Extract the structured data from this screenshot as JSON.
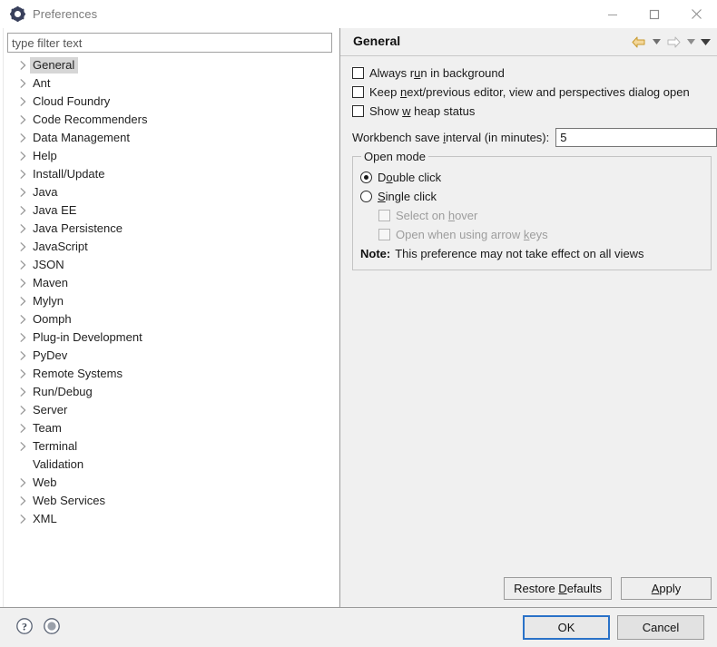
{
  "window": {
    "title": "Preferences",
    "icon": "gear-icon",
    "controls": {
      "minimize": "minimize-icon",
      "maximize": "maximize-icon",
      "close": "close-icon"
    }
  },
  "filter": {
    "placeholder": "type filter text",
    "value": ""
  },
  "tree": {
    "items": [
      {
        "label": "General",
        "expandable": true,
        "selected": true
      },
      {
        "label": "Ant",
        "expandable": true,
        "selected": false
      },
      {
        "label": "Cloud Foundry",
        "expandable": true,
        "selected": false
      },
      {
        "label": "Code Recommenders",
        "expandable": true,
        "selected": false
      },
      {
        "label": "Data Management",
        "expandable": true,
        "selected": false
      },
      {
        "label": "Help",
        "expandable": true,
        "selected": false
      },
      {
        "label": "Install/Update",
        "expandable": true,
        "selected": false
      },
      {
        "label": "Java",
        "expandable": true,
        "selected": false
      },
      {
        "label": "Java EE",
        "expandable": true,
        "selected": false
      },
      {
        "label": "Java Persistence",
        "expandable": true,
        "selected": false
      },
      {
        "label": "JavaScript",
        "expandable": true,
        "selected": false
      },
      {
        "label": "JSON",
        "expandable": true,
        "selected": false
      },
      {
        "label": "Maven",
        "expandable": true,
        "selected": false
      },
      {
        "label": "Mylyn",
        "expandable": true,
        "selected": false
      },
      {
        "label": "Oomph",
        "expandable": true,
        "selected": false
      },
      {
        "label": "Plug-in Development",
        "expandable": true,
        "selected": false
      },
      {
        "label": "PyDev",
        "expandable": true,
        "selected": false
      },
      {
        "label": "Remote Systems",
        "expandable": true,
        "selected": false
      },
      {
        "label": "Run/Debug",
        "expandable": true,
        "selected": false
      },
      {
        "label": "Server",
        "expandable": true,
        "selected": false
      },
      {
        "label": "Team",
        "expandable": true,
        "selected": false
      },
      {
        "label": "Terminal",
        "expandable": true,
        "selected": false
      },
      {
        "label": "Validation",
        "expandable": false,
        "selected": false
      },
      {
        "label": "Web",
        "expandable": true,
        "selected": false
      },
      {
        "label": "Web Services",
        "expandable": true,
        "selected": false
      },
      {
        "label": "XML",
        "expandable": true,
        "selected": false
      }
    ]
  },
  "pane": {
    "title": "General",
    "nav": {
      "back": "back-arrow-icon",
      "back_menu": "chevron-down-icon",
      "forward": "forward-arrow-icon",
      "forward_menu": "chevron-down-icon",
      "view_menu": "chevron-down-icon"
    },
    "checkboxes": [
      {
        "label_pre": "Always r",
        "mnemonic": "u",
        "label_post": "n in background",
        "checked": false,
        "enabled": true
      },
      {
        "label_pre": "Keep ",
        "mnemonic": "n",
        "label_post": "ext/previous editor, view and perspectives dialog open",
        "checked": false,
        "enabled": true
      },
      {
        "label_pre": "Show ",
        "mnemonic": "w",
        "label_post": " heap status",
        "checked": false,
        "enabled": true
      }
    ],
    "save_interval": {
      "label_pre": "Workbench save ",
      "mnemonic": "i",
      "label_post": "nterval (in minutes):",
      "value": "5"
    },
    "open_mode": {
      "title": "Open mode",
      "radios": [
        {
          "label_pre": "D",
          "mnemonic": "o",
          "label_post": "uble click",
          "checked": true
        },
        {
          "label_pre": "",
          "mnemonic": "S",
          "label_post": "ingle click",
          "checked": false
        }
      ],
      "sub_checkboxes": [
        {
          "label_pre": "Select on ",
          "mnemonic": "h",
          "label_post": "over",
          "checked": false,
          "enabled": false
        },
        {
          "label_pre": "Open when using arrow ",
          "mnemonic": "k",
          "label_post": "eys",
          "checked": false,
          "enabled": false
        }
      ],
      "note_label": "Note:",
      "note_text": "This preference may not take effect on all views"
    },
    "buttons": {
      "restore_pre": "Restore ",
      "restore_mnemonic": "D",
      "restore_post": "efaults",
      "apply_pre": "",
      "apply_mnemonic": "A",
      "apply_post": "pply"
    }
  },
  "footer": {
    "help_icon": "question-mark-help-icon",
    "secondary_icon": "circle-icon",
    "ok": "OK",
    "cancel": "Cancel"
  },
  "colors": {
    "accent": "#2a72c8",
    "nav_back": "#e8b54a",
    "pane_bg": "#f0f0f0",
    "tree_selection": "#d6d6d6"
  }
}
